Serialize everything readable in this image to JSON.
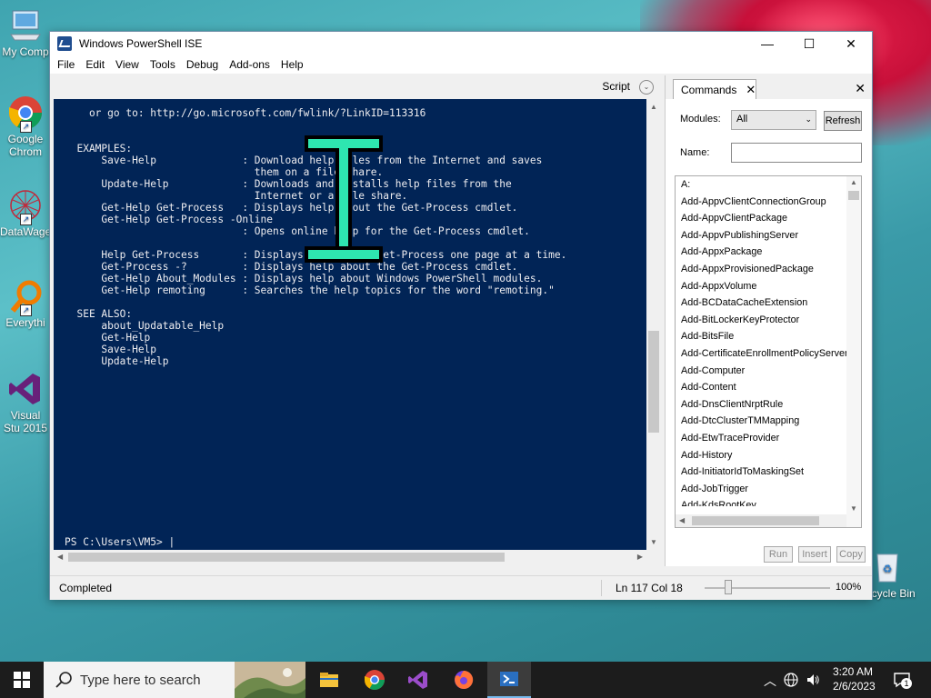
{
  "desktop": {
    "icons": [
      {
        "label": "My Comp"
      },
      {
        "label": "Google Chrom"
      },
      {
        "label": "DataWage"
      },
      {
        "label": "Everythi"
      },
      {
        "label": "Visual Stu 2015"
      },
      {
        "label": "Recycle Bin"
      }
    ]
  },
  "window": {
    "title": "Windows PowerShell ISE",
    "controls": {
      "minimize": "—",
      "maximize": "☐",
      "close": "✕"
    },
    "menu": [
      "File",
      "Edit",
      "View",
      "Tools",
      "Debug",
      "Add-ons",
      "Help"
    ]
  },
  "script_pane": {
    "label": "Script",
    "toggle_icon": "⌄"
  },
  "console": {
    "output": "    or go to: http://go.microsoft.com/fwlink/?LinkID=113316\n\n\n  EXAMPLES:\n      Save-Help              : Download help files from the Internet and saves\n                               them on a file share.\n      Update-Help            : Downloads and installs help files from the\n                               Internet or a file share.\n      Get-Help Get-Process   : Displays help about the Get-Process cmdlet.\n      Get-Help Get-Process -Online\n                             : Opens online help for the Get-Process cmdlet.\n\n      Help Get-Process       : Displays help about Get-Process one page at a time.\n      Get-Process -?         : Displays help about the Get-Process cmdlet.\n      Get-Help About_Modules : Displays help about Windows PowerShell modules.\n      Get-Help remoting      : Searches the help topics for the word \"remoting.\"\n\n  SEE ALSO:\n      about_Updatable_Help\n      Get-Help\n      Save-Help\n      Update-Help",
    "prompt": "PS C:\\Users\\VM5> |"
  },
  "commands": {
    "tab_label": "Commands",
    "tab_close": "✕",
    "pane_close": "✕",
    "modules_label": "Modules:",
    "modules_value": "All",
    "refresh_label": "Refresh",
    "name_label": "Name:",
    "name_value": "",
    "items": [
      "A:",
      "Add-AppvClientConnectionGroup",
      "Add-AppvClientPackage",
      "Add-AppvPublishingServer",
      "Add-AppxPackage",
      "Add-AppxProvisionedPackage",
      "Add-AppxVolume",
      "Add-BCDataCacheExtension",
      "Add-BitLockerKeyProtector",
      "Add-BitsFile",
      "Add-CertificateEnrollmentPolicyServer",
      "Add-Computer",
      "Add-Content",
      "Add-DnsClientNrptRule",
      "Add-DtcClusterTMMapping",
      "Add-EtwTraceProvider",
      "Add-History",
      "Add-InitiatorIdToMaskingSet",
      "Add-JobTrigger",
      "Add-KdsRootKey"
    ],
    "run_label": "Run",
    "insert_label": "Insert",
    "copy_label": "Copy"
  },
  "status": {
    "text": "Completed",
    "position": "Ln 117  Col 18",
    "zoom": "100%"
  },
  "taskbar": {
    "search_placeholder": "Type here to search",
    "time": "3:20 AM",
    "date": "2/6/2023",
    "notification_count": "1"
  },
  "colors": {
    "console_bg": "#012456",
    "console_fg": "#eeedf0",
    "caret_accent": "#2ee6b0"
  }
}
